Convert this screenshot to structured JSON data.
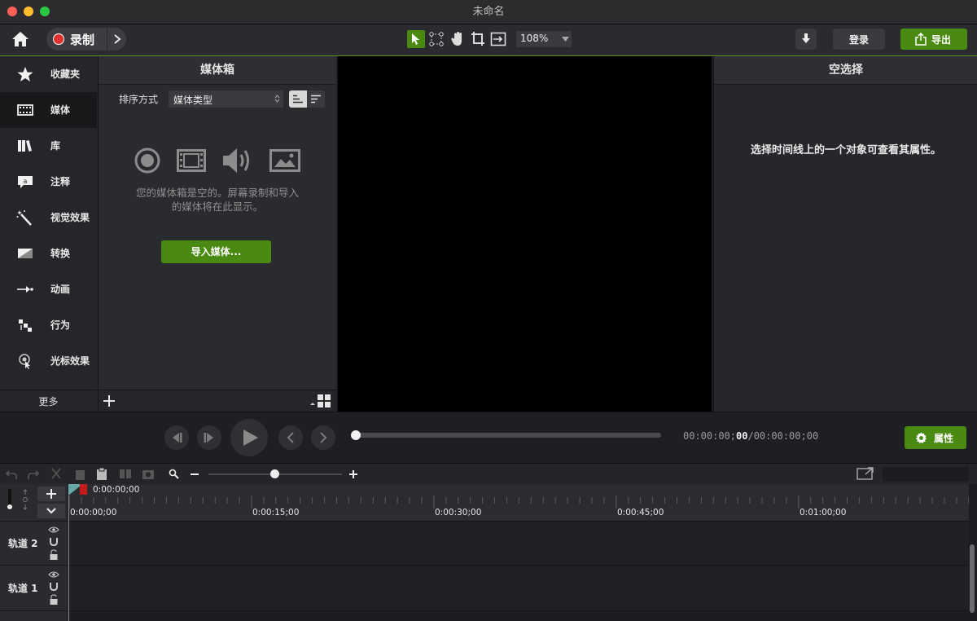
{
  "window": {
    "title": "未命名"
  },
  "toolbar": {
    "record_label": "录制",
    "zoom_value": "108%",
    "signin_label": "登录",
    "export_label": "导出"
  },
  "sidebar": {
    "items": [
      {
        "label": "收藏夹",
        "icon": "star-icon"
      },
      {
        "label": "媒体",
        "icon": "film-icon"
      },
      {
        "label": "库",
        "icon": "library-icon"
      },
      {
        "label": "注释",
        "icon": "annotation-icon"
      },
      {
        "label": "视觉效果",
        "icon": "magic-wand-icon"
      },
      {
        "label": "转换",
        "icon": "transition-icon"
      },
      {
        "label": "动画",
        "icon": "animation-icon"
      },
      {
        "label": "行为",
        "icon": "behavior-icon"
      },
      {
        "label": "光标效果",
        "icon": "cursor-effect-icon"
      }
    ],
    "more_label": "更多"
  },
  "media_bin": {
    "title": "媒体箱",
    "sort_label": "排序方式",
    "sort_value": "媒体类型",
    "empty_line1": "您的媒体箱是空的。屏幕录制和导入",
    "empty_line2": "的媒体将在此显示。",
    "import_label": "导入媒体..."
  },
  "properties": {
    "title": "空选择",
    "hint": "选择时间线上的一个对象可查看其属性。"
  },
  "playback": {
    "time_current": "00:00:00;",
    "time_frame": "00",
    "time_total": "/00:00:00;00",
    "properties_label": "属性",
    "progress": 0
  },
  "timeline": {
    "playhead_time": "0:00:00;00",
    "ticks": [
      "0:00:00;00",
      "0:00:15;00",
      "0:00:30;00",
      "0:00:45;00",
      "0:01:00;00"
    ],
    "tracks": [
      "轨道 2",
      "轨道 1"
    ]
  },
  "colors": {
    "accent": "#4b8a12",
    "record": "#e0302a"
  }
}
